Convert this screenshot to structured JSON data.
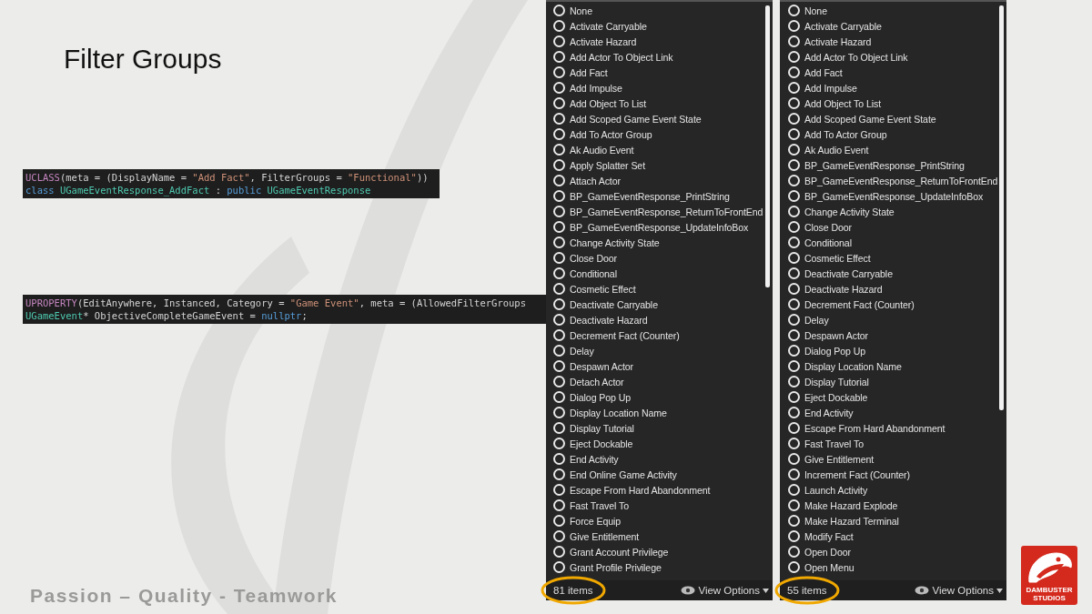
{
  "slide": {
    "title": "Filter Groups",
    "footer": "Passion – Quality - Teamwork"
  },
  "code_blocks": [
    {
      "lines": [
        [
          {
            "kind": "macro",
            "text": "UCLASS"
          },
          {
            "kind": "plain",
            "text": "(meta = (DisplayName = "
          },
          {
            "kind": "string",
            "text": "\"Add Fact\""
          },
          {
            "kind": "plain",
            "text": ", FilterGroups = "
          },
          {
            "kind": "string",
            "text": "\"Functional\""
          },
          {
            "kind": "plain",
            "text": "))"
          }
        ],
        [
          {
            "kind": "keyword",
            "text": "class "
          },
          {
            "kind": "type",
            "text": "UGameEventResponse_AddFact"
          },
          {
            "kind": "plain",
            "text": " : "
          },
          {
            "kind": "keyword",
            "text": "public "
          },
          {
            "kind": "type",
            "text": "UGameEventResponse"
          }
        ]
      ]
    },
    {
      "lines": [
        [
          {
            "kind": "macro",
            "text": "UPROPERTY"
          },
          {
            "kind": "plain",
            "text": "(EditAnywhere, Instanced, Category = "
          },
          {
            "kind": "string",
            "text": "\"Game Event\""
          },
          {
            "kind": "plain",
            "text": ", meta = (AllowedFilterGroups"
          }
        ],
        [
          {
            "kind": "type",
            "text": "UGameEvent"
          },
          {
            "kind": "plain",
            "text": "* ObjectiveCompleteGameEvent = "
          },
          {
            "kind": "keyword",
            "text": "nullptr"
          },
          {
            "kind": "plain",
            "text": ";"
          }
        ]
      ]
    }
  ],
  "lists": [
    {
      "items": [
        "None",
        "Activate Carryable",
        "Activate Hazard",
        "Add Actor To Object Link",
        "Add Fact",
        "Add Impulse",
        "Add Object To List",
        "Add Scoped Game Event State",
        "Add To Actor Group",
        "Ak Audio Event",
        "Apply Splatter Set",
        "Attach Actor",
        "BP_GameEventResponse_PrintString",
        "BP_GameEventResponse_ReturnToFrontEnd",
        "BP_GameEventResponse_UpdateInfoBox",
        "Change Activity State",
        "Close Door",
        "Conditional",
        "Cosmetic Effect",
        "Deactivate Carryable",
        "Deactivate Hazard",
        "Decrement Fact (Counter)",
        "Delay",
        "Despawn Actor",
        "Detach Actor",
        "Dialog Pop Up",
        "Display Location Name",
        "Display Tutorial",
        "Eject Dockable",
        "End Activity",
        "End Online Game Activity",
        "Escape From Hard Abandonment",
        "Fast Travel To",
        "Force Equip",
        "Give Entitlement",
        "Grant Account Privilege",
        "Grant Profile Privilege"
      ],
      "count": "81 items",
      "view_options": "View Options"
    },
    {
      "items": [
        "None",
        "Activate Carryable",
        "Activate Hazard",
        "Add Actor To Object Link",
        "Add Fact",
        "Add Impulse",
        "Add Object To List",
        "Add Scoped Game Event State",
        "Add To Actor Group",
        "Ak Audio Event",
        "BP_GameEventResponse_PrintString",
        "BP_GameEventResponse_ReturnToFrontEnd",
        "BP_GameEventResponse_UpdateInfoBox",
        "Change Activity State",
        "Close Door",
        "Conditional",
        "Cosmetic Effect",
        "Deactivate Carryable",
        "Deactivate Hazard",
        "Decrement Fact (Counter)",
        "Delay",
        "Despawn Actor",
        "Dialog Pop Up",
        "Display Location Name",
        "Display Tutorial",
        "Eject Dockable",
        "End Activity",
        "Escape From Hard Abandonment",
        "Fast Travel To",
        "Give Entitlement",
        "Increment Fact (Counter)",
        "Launch Activity",
        "Make Hazard Explode",
        "Make Hazard Terminal",
        "Modify Fact",
        "Open Door",
        "Open Menu"
      ],
      "count": "55 items",
      "view_options": "View Options"
    }
  ],
  "logo": {
    "line_1": "DAMBUSTER",
    "line_2": "STUDIOS"
  }
}
